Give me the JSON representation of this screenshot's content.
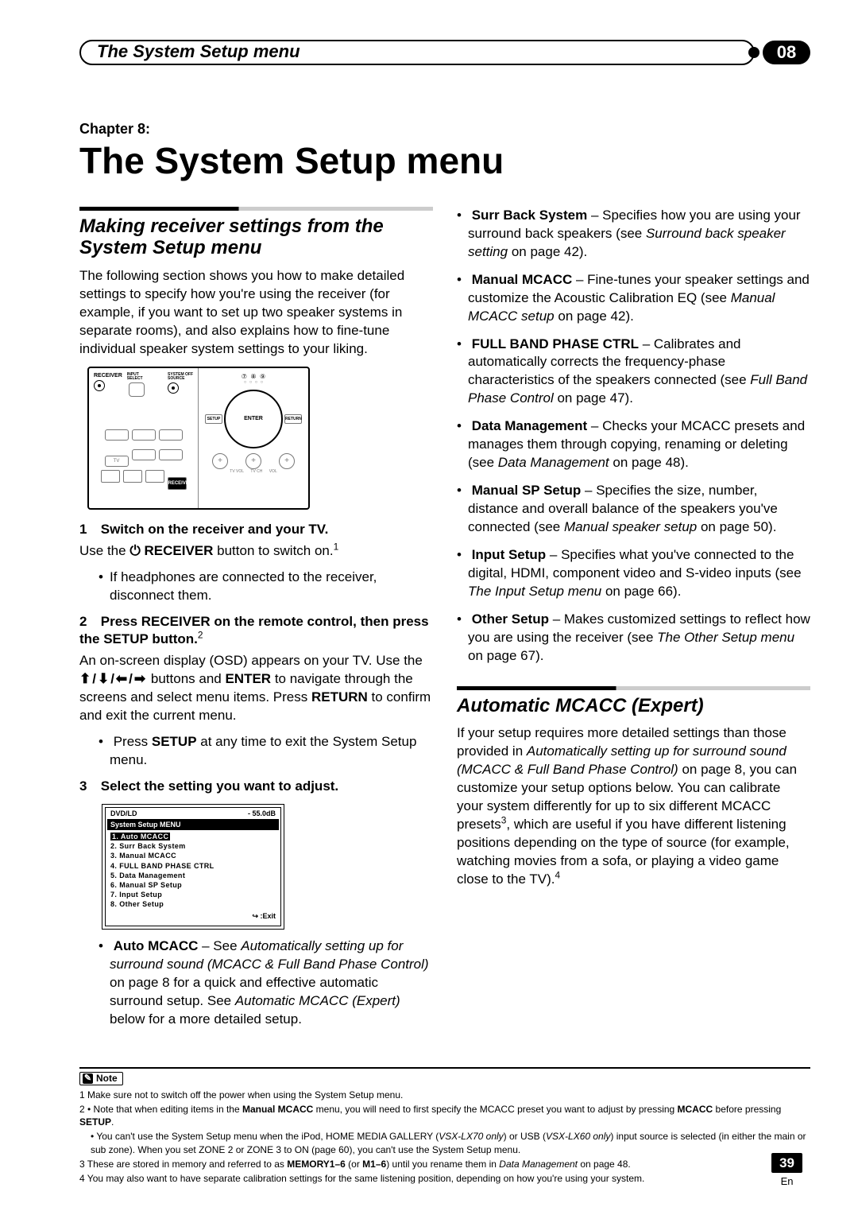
{
  "header": {
    "running_title": "The System Setup menu",
    "chapter_number": "08"
  },
  "chapter": {
    "label": "Chapter 8:",
    "title": "The System Setup menu"
  },
  "left": {
    "sec1_title": "Making receiver settings from the System Setup menu",
    "intro": "The following section shows you how to make detailed settings to specify how you're using the receiver (for example, if you want to set up two speaker systems in separate rooms), and also explains how to fine-tune individual speaker system settings to your liking.",
    "step1_num": "1",
    "step1_title": "Switch on the receiver and your TV.",
    "step1_line_pre": "Use the ",
    "step1_glyph": "⏻ ",
    "step1_bold": "RECEIVER",
    "step1_line_post": " button to switch on.",
    "step1_sup": "1",
    "step1_bullet": "If headphones are connected to the receiver, disconnect them.",
    "step2_num": "2",
    "step2_title_a": "Press RECEIVER on the remote control, then press the SETUP button.",
    "step2_sup": "2",
    "step2_body_a": "An on-screen display (OSD) appears on your TV. Use the",
    "step2_arrows": "⬆/⬇/⬅/➡",
    "step2_body_b": " buttons and ",
    "step2_enter": "ENTER",
    "step2_body_c": " to navigate through the screens and select menu items. Press ",
    "step2_return": "RETURN",
    "step2_body_d": " to confirm and exit the current menu.",
    "step2_bullet_a": "Press ",
    "step2_bullet_b": "SETUP",
    "step2_bullet_c": " at any time to exit the System Setup menu.",
    "step3_num": "3",
    "step3_title": "Select the setting you want to adjust.",
    "osd": {
      "source": "DVD/LD",
      "level": "- 55.0dB",
      "title": "System Setup MENU",
      "items": [
        "1. Auto MCACC",
        "2. Surr Back System",
        "3. Manual MCACC",
        "4. FULL BAND PHASE CTRL",
        "5. Data Management",
        "6. Manual SP Setup",
        "7. Input Setup",
        "8. Other Setup"
      ],
      "exit": "↪ :Exit"
    },
    "auto_mcacc_lead": "Auto MCACC",
    "auto_mcacc_dash": " – See ",
    "auto_mcacc_ital": "Automatically setting up for surround sound (MCACC & Full Band Phase Control)",
    "auto_mcacc_rest_a": " on page 8 for a quick and effective automatic surround setup. See ",
    "auto_mcacc_ital2": "Automatic MCACC (Expert)",
    "auto_mcacc_rest_b": " below for a more detailed setup."
  },
  "right": {
    "surr_lead": "Surr Back System",
    "surr_txt_a": " – Specifies how you are using your surround back speakers (see ",
    "surr_ital": "Surround back speaker setting",
    "surr_txt_b": " on page 42).",
    "mmcacc_lead": "Manual MCACC",
    "mmcacc_txt_a": " – Fine-tunes your speaker settings and customize the Acoustic Calibration EQ (see ",
    "mmcacc_ital": "Manual MCACC setup",
    "mmcacc_txt_b": " on page 42).",
    "fbpc_lead": "FULL BAND PHASE CTRL",
    "fbpc_txt_a": " – Calibrates and automatically corrects the frequency-phase characteristics of the speakers connected (see ",
    "fbpc_ital": "Full Band Phase Control",
    "fbpc_txt_b": " on page 47).",
    "dm_lead": "Data Management",
    "dm_txt_a": " – Checks your MCACC presets and manages them through copying, renaming or deleting (see ",
    "dm_ital": "Data Management",
    "dm_txt_b": " on page 48).",
    "sp_lead": "Manual SP Setup",
    "sp_txt_a": " – Specifies the size, number, distance and overall balance of the speakers you've connected (see ",
    "sp_ital": "Manual speaker setup",
    "sp_txt_b": " on page 50).",
    "in_lead": "Input Setup",
    "in_txt_a": " – Specifies what you've connected to the digital, HDMI, component video and S-video inputs (see ",
    "in_ital": "The Input Setup menu",
    "in_txt_b": " on page 66).",
    "os_lead": "Other Setup",
    "os_txt_a": " – Makes customized settings to reflect how you are using the receiver (see ",
    "os_ital": "The Other Setup menu",
    "os_txt_b": " on page 67).",
    "sec2_title": "Automatic MCACC (Expert)",
    "sec2_body_a": "If your setup requires more detailed settings than those provided in ",
    "sec2_ital": "Automatically setting up for surround sound (MCACC & Full Band Phase Control)",
    "sec2_body_b": " on page 8, you can customize your setup options below. You can calibrate your system differently for up to six different MCACC presets",
    "sec2_sup1": "3",
    "sec2_body_c": ", which are useful if you have different listening positions depending on the type of source (for example, watching movies from a sofa, or playing a video game close to the TV).",
    "sec2_sup2": "4"
  },
  "notes": {
    "badge": "Note",
    "n1": "1 Make sure not to switch off the power when using the System Setup menu.",
    "n2a": "2 • Note that when editing items in the ",
    "n2a_b1": "Manual MCACC",
    "n2a_mid": " menu, you will need to first specify the MCACC preset you want to adjust by pressing ",
    "n2a_b2": "MCACC",
    "n2a_end": " before pressing ",
    "n2a_b3": "SETUP",
    "n2a_period": ".",
    "n2b": "• You can't use the System Setup menu when the iPod, HOME MEDIA GALLERY (",
    "n2b_i1": "VSX-LX70 only",
    "n2b_mid": ") or USB (",
    "n2b_i2": "VSX-LX60 only",
    "n2b_end": ") input source is selected (in either the main or sub zone). When you set ZONE 2 or ZONE 3 to ON (page 60), you can't use the System Setup menu.",
    "n3a": "3 These are stored in memory and referred to as ",
    "n3_b1": "MEMORY1–6",
    "n3_mid": " (or ",
    "n3_b2": "M1–6",
    "n3_end_a": ") until you rename them in ",
    "n3_i": "Data Management",
    "n3_end_b": " on page 48.",
    "n4": "4 You may also want to have separate calibration settings for the same listening position, depending on how you're using your system."
  },
  "page": {
    "num": "39",
    "lang": "En"
  }
}
